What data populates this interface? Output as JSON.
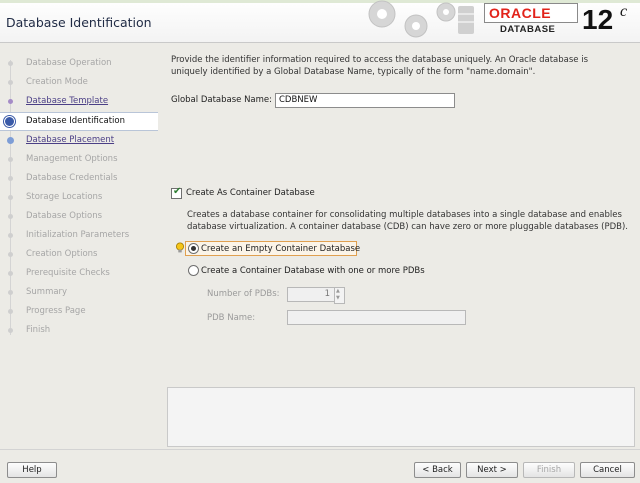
{
  "header": {
    "title": "Database Identification",
    "brand": "ORACLE",
    "brand_sub": "DATABASE",
    "version": "12",
    "version_suffix": "c",
    "accent": "#e2231a"
  },
  "sidebar": {
    "items": [
      {
        "label": "Database Operation",
        "state": "inactive"
      },
      {
        "label": "Creation Mode",
        "state": "inactive"
      },
      {
        "label": "Database Template",
        "state": "done"
      },
      {
        "label": "Database Identification",
        "state": "active"
      },
      {
        "label": "Database Placement",
        "state": "next"
      },
      {
        "label": "Management Options",
        "state": "inactive"
      },
      {
        "label": "Database Credentials",
        "state": "inactive"
      },
      {
        "label": "Storage Locations",
        "state": "inactive"
      },
      {
        "label": "Database Options",
        "state": "inactive"
      },
      {
        "label": "Initialization Parameters",
        "state": "inactive"
      },
      {
        "label": "Creation Options",
        "state": "inactive"
      },
      {
        "label": "Prerequisite Checks",
        "state": "inactive"
      },
      {
        "label": "Summary",
        "state": "inactive"
      },
      {
        "label": "Progress Page",
        "state": "inactive"
      },
      {
        "label": "Finish",
        "state": "inactive"
      }
    ]
  },
  "main": {
    "description": "Provide the identifier information required to access the database uniquely. An Oracle database is uniquely identified by a Global Database Name, typically of the form \"name.domain\".",
    "gdn_label": "Global Database Name:",
    "gdn_value": "CDBNEW",
    "container_checkbox_label": "Create As Container Database",
    "container_checked": true,
    "container_description": "Creates a database container for consolidating multiple databases into a single database and enables database virtualization. A container database (CDB) can have zero or more pluggable databases (PDB).",
    "radio_empty_label": "Create an Empty Container Database",
    "radio_with_pdbs_label": "Create a Container Database with one or more PDBs",
    "selected_radio": "empty",
    "num_pdbs_label": "Number of PDBs:",
    "num_pdbs_value": "1",
    "pdb_name_label": "PDB Name:",
    "pdb_name_value": ""
  },
  "footer": {
    "help": "Help",
    "back": "< Back",
    "next": "Next >",
    "finish": "Finish",
    "cancel": "Cancel"
  }
}
